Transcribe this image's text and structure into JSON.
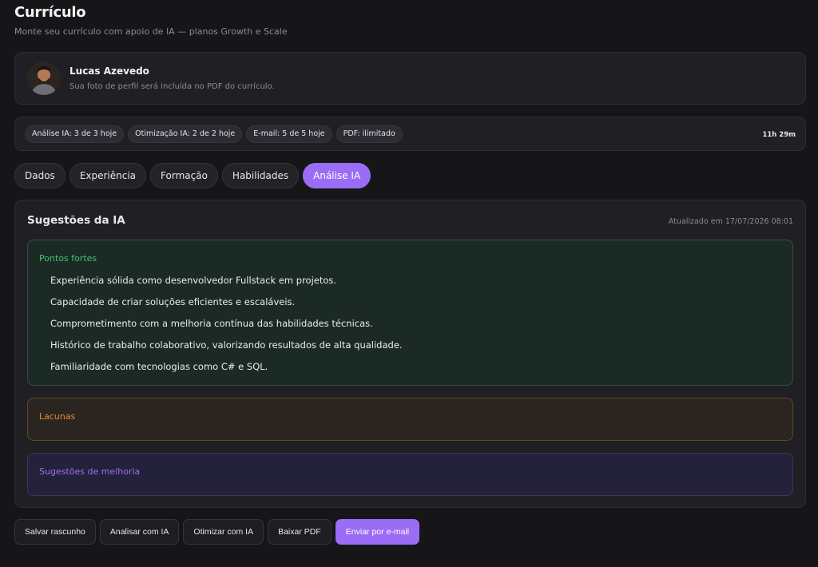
{
  "header": {
    "title": "Currículo",
    "subtitle": "Monte seu currículo com apoio de IA — planos Growth e Scale"
  },
  "profile": {
    "name": "Lucas Azevedo",
    "hint": "Sua foto de perfil será incluída no PDF do currículo."
  },
  "quotas": {
    "items": [
      {
        "label": "Análise IA: 3 de 3 hoje"
      },
      {
        "label": "Otimização IA: 2 de 2 hoje"
      },
      {
        "label": "E-mail: 5 de 5 hoje"
      },
      {
        "label": "PDF: ilimitado"
      }
    ],
    "timer": "11h 29m"
  },
  "tabs": [
    {
      "label": "Dados",
      "active": false
    },
    {
      "label": "Experiência",
      "active": false
    },
    {
      "label": "Formação",
      "active": false
    },
    {
      "label": "Habilidades",
      "active": false
    },
    {
      "label": "Análise IA",
      "active": true
    }
  ],
  "ai": {
    "title": "Sugestões da IA",
    "updated": "Atualizado em 17/07/2026 08:01",
    "strengths": {
      "title": "Pontos fortes",
      "items": [
        "Experiência sólida como desenvolvedor Fullstack em projetos.",
        "Capacidade de criar soluções eficientes e escaláveis.",
        "Comprometimento com a melhoria contínua das habilidades técnicas.",
        "Histórico de trabalho colaborativo, valorizando resultados de alta qualidade.",
        "Familiaridade com tecnologias como C# e SQL."
      ]
    },
    "gaps": {
      "title": "Lacunas"
    },
    "improvements": {
      "title": "Sugestões de melhoria"
    }
  },
  "actions": {
    "save_draft": "Salvar rascunho",
    "analyze": "Analisar com IA",
    "optimize": "Otimizar com IA",
    "download_pdf": "Baixar PDF",
    "send_email": "Enviar por e-mail"
  },
  "colors": {
    "accent": "#9b6cf5",
    "strengths": "#3ec46d",
    "gaps": "#e18d2c",
    "improvements": "#9a72ee"
  }
}
